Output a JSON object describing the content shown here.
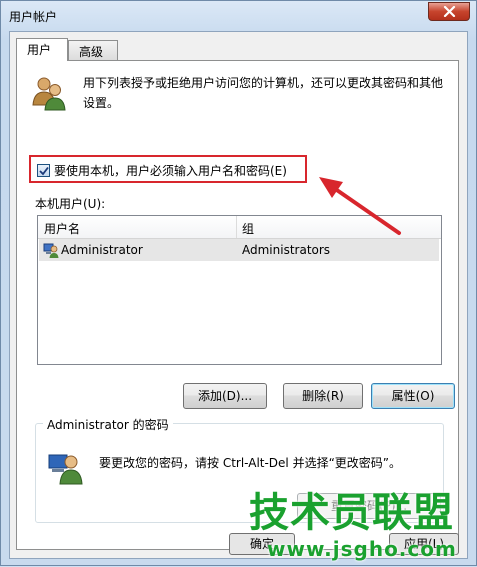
{
  "window": {
    "title": "用户帐户"
  },
  "tabs": [
    {
      "label": "用户"
    },
    {
      "label": "高级"
    }
  ],
  "intro": {
    "text": "用下列表授予或拒绝用户访问您的计算机，还可以更改其密码和其他设置。"
  },
  "require_login": {
    "label": "要使用本机，用户必须输入用户名和密码(E)",
    "checked": true
  },
  "users_list": {
    "label": "本机用户(U):",
    "columns": [
      "用户名",
      "组"
    ],
    "rows": [
      {
        "user": "Administrator",
        "group": "Administrators"
      }
    ]
  },
  "buttons": {
    "add": "添加(D)...",
    "remove": "删除(R)",
    "properties": "属性(O)"
  },
  "password_group": {
    "title": "Administrator 的密码",
    "text": "要更改您的密码，请按 Ctrl-Alt-Del 并选择“更改密码”。",
    "reset_button": "重置密码(P)..."
  },
  "footer": {
    "ok_partial": "确定",
    "apply_partial": "应用(L)"
  },
  "watermark": {
    "brand": "技术员联盟",
    "url": "www.jsgho.com"
  },
  "colors": {
    "highlight_border": "#d8262d",
    "arrow": "#d8262d",
    "watermark": "#1aa12f"
  }
}
